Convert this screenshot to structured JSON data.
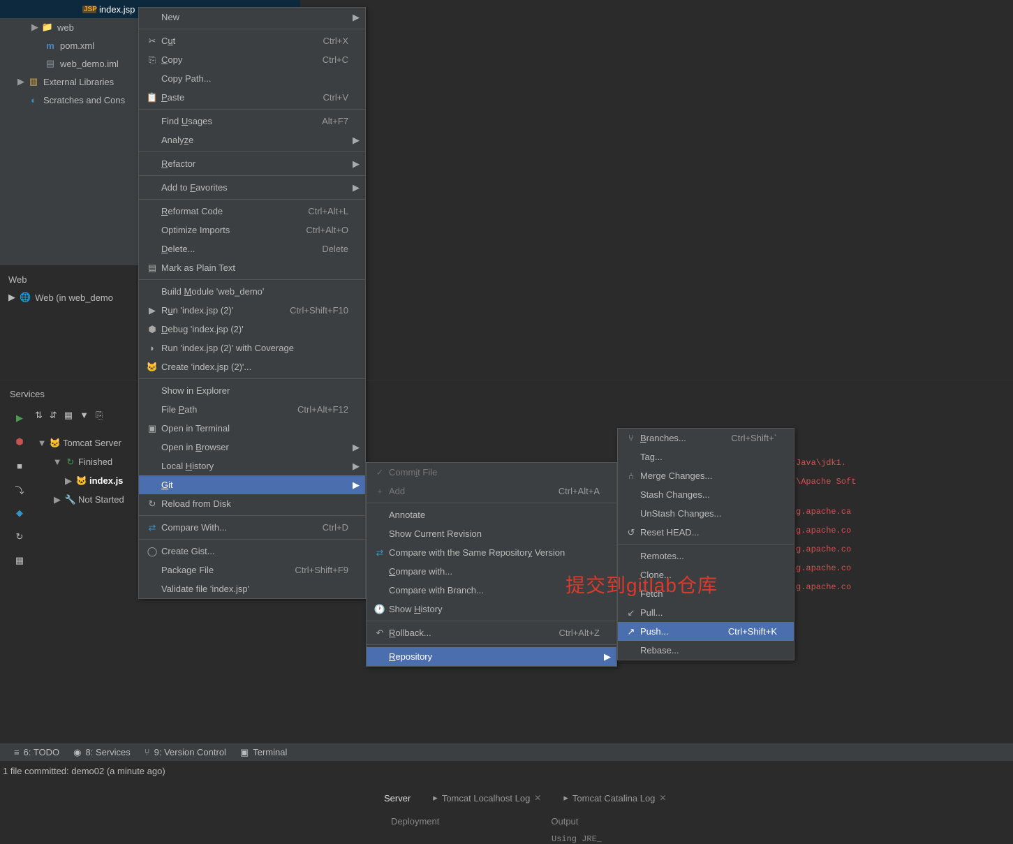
{
  "tree": {
    "index_jsp": "index.jsp",
    "web": "web",
    "pom": "pom.xml",
    "iml": "web_demo.iml",
    "ext_lib": "External Libraries",
    "scratches": "Scratches and Cons"
  },
  "web_panel": {
    "title": "Web",
    "row": "Web (in web_demo"
  },
  "services": {
    "title": "Services",
    "tomcat": "Tomcat Server",
    "finished": "Finished",
    "index": "index.js",
    "notstarted": "Not Started"
  },
  "tabs": {
    "server": "Server",
    "localhost": "Tomcat Localhost Log",
    "catalina": "Tomcat Catalina Log"
  },
  "svc_cols": {
    "dep": "Deployment",
    "out": "Output"
  },
  "console": {
    "jre": "Using  JRE_",
    "l1": "Java\\jdk1.",
    "l2": "\\Apache Soft",
    "l3": "g.apache.ca",
    "l4": "g.apache.co",
    "l5": "g.apache.co",
    "l6": "g.apache.co",
    "l7": "g.apache.co"
  },
  "menu1": {
    "new": "New",
    "cut": "Cut",
    "cut_sc": "Ctrl+X",
    "copy": "Copy",
    "copy_sc": "Ctrl+C",
    "copypath": "Copy Path...",
    "paste": "Paste",
    "paste_sc": "Ctrl+V",
    "findusages": "Find Usages",
    "findusages_sc": "Alt+F7",
    "analyze": "Analyze",
    "refactor": "Refactor",
    "addfav": "Add to Favorites",
    "reformat": "Reformat Code",
    "reformat_sc": "Ctrl+Alt+L",
    "optimize": "Optimize Imports",
    "optimize_sc": "Ctrl+Alt+O",
    "delete": "Delete...",
    "delete_sc": "Delete",
    "markplain": "Mark as Plain Text",
    "buildmod": "Build Module 'web_demo'",
    "run": "Run 'index.jsp (2)'",
    "run_sc": "Ctrl+Shift+F10",
    "debug": "Debug 'index.jsp (2)'",
    "coverage": "Run 'index.jsp (2)' with Coverage",
    "create": "Create 'index.jsp (2)'...",
    "explorer": "Show in Explorer",
    "filepath": "File Path",
    "filepath_sc": "Ctrl+Alt+F12",
    "terminal": "Open in Terminal",
    "browser": "Open in Browser",
    "history": "Local History",
    "git": "Git",
    "reload": "Reload from Disk",
    "compare": "Compare With...",
    "compare_sc": "Ctrl+D",
    "gist": "Create Gist...",
    "package": "Package File",
    "package_sc": "Ctrl+Shift+F9",
    "validate": "Validate file 'index.jsp'"
  },
  "menu2": {
    "commit": "Commit File",
    "add": "Add",
    "add_sc": "Ctrl+Alt+A",
    "annotate": "Annotate",
    "showrev": "Show Current Revision",
    "comparesame": "Compare with the Same Repository Version",
    "comparewith": "Compare with...",
    "comparebranch": "Compare with Branch...",
    "showhist": "Show History",
    "rollback": "Rollback...",
    "rollback_sc": "Ctrl+Alt+Z",
    "repository": "Repository"
  },
  "menu3": {
    "branches": "Branches...",
    "branches_sc": "Ctrl+Shift+`",
    "tag": "Tag...",
    "merge": "Merge Changes...",
    "stash": "Stash Changes...",
    "unstash": "UnStash Changes...",
    "reset": "Reset HEAD...",
    "remotes": "Remotes...",
    "clone": "Clone...",
    "fetch": "Fetch",
    "pull": "Pull...",
    "push": "Push...",
    "push_sc": "Ctrl+Shift+K",
    "rebase": "Rebase..."
  },
  "bottom": {
    "todo": "6: TODO",
    "services": "8: Services",
    "vcs": "9: Version Control",
    "terminal": "Terminal"
  },
  "status": "1 file committed: demo02 (a minute ago)",
  "overlay": "提交到gitlab仓库"
}
